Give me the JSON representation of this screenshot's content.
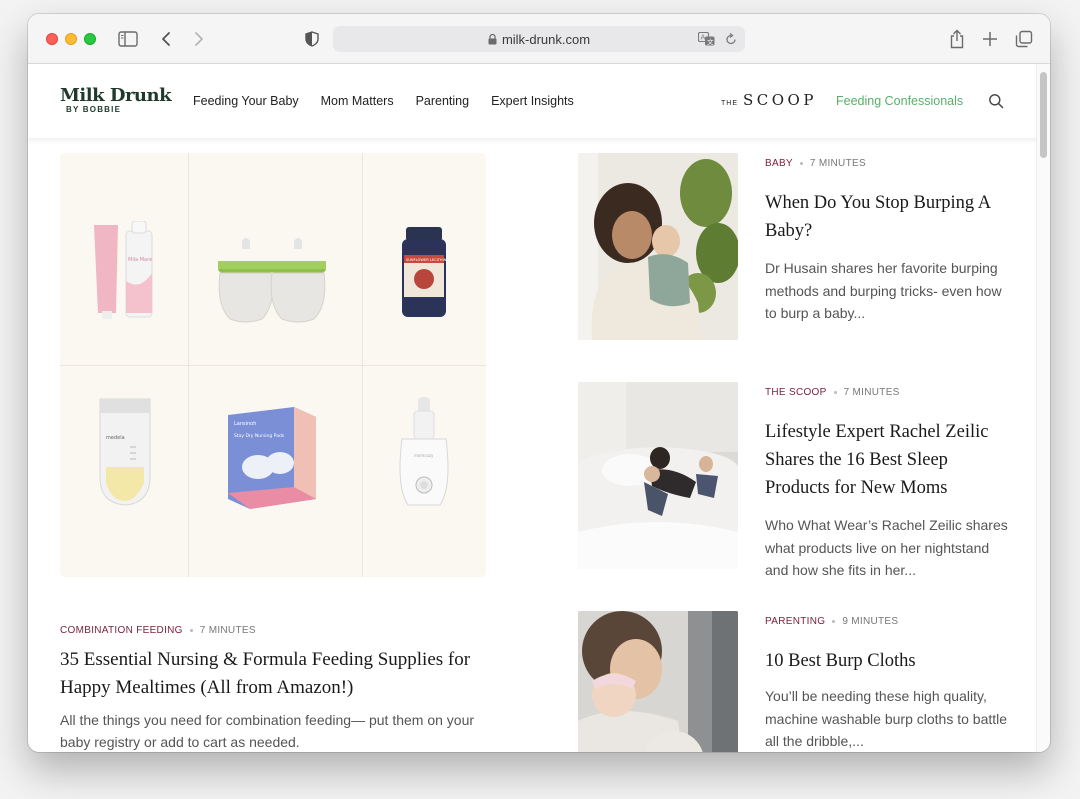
{
  "browser": {
    "url": "milk-drunk.com"
  },
  "site": {
    "logo_main": "Milk Drunk",
    "logo_sub": "BY BOBBIE",
    "nav": [
      "Feeding Your Baby",
      "Mom Matters",
      "Parenting",
      "Expert Insights"
    ],
    "scoop_the": "THE",
    "scoop_word": "SCOOP",
    "confessionals": "Feeding Confessionals",
    "accent_color": "#58b06a",
    "category_color": "#7b1f3a"
  },
  "hero": {
    "category": "COMBINATION FEEDING",
    "minutes": "7 MINUTES",
    "title": "35 Essential Nursing & Formula Feeding Supplies for Happy Mealtimes (All from Amazon!)",
    "description": "All the things you need for combination feeding— put them on your baby registry or add to cart as needed.",
    "products": {
      "cream_brand": "Mila Mare",
      "lecithin": "SUNFLOWER LECITHIN",
      "bag_brand": "medela",
      "pads_brand": "Lansinoh",
      "pads_name": "Stay Dry Nursing Pads",
      "warmer_brand": "momcozy"
    }
  },
  "articles": [
    {
      "category": "BABY",
      "minutes": "7 MINUTES",
      "title": "When Do You Stop Burping A Baby?",
      "description": "Dr Husain shares her favorite burping methods and burping tricks- even how to burp a baby..."
    },
    {
      "category": "THE SCOOP",
      "minutes": "7 MINUTES",
      "title": "Lifestyle Expert Rachel Zeilic Shares the 16 Best Sleep Products for New Moms",
      "description": "Who What Wear’s Rachel Zeilic shares what products live on her nightstand and how she fits in her..."
    },
    {
      "category": "PARENTING",
      "minutes": "9 MINUTES",
      "title": "10 Best Burp Cloths",
      "description": "You’ll be needing these high quality, machine washable burp cloths to battle all the dribble,..."
    }
  ]
}
